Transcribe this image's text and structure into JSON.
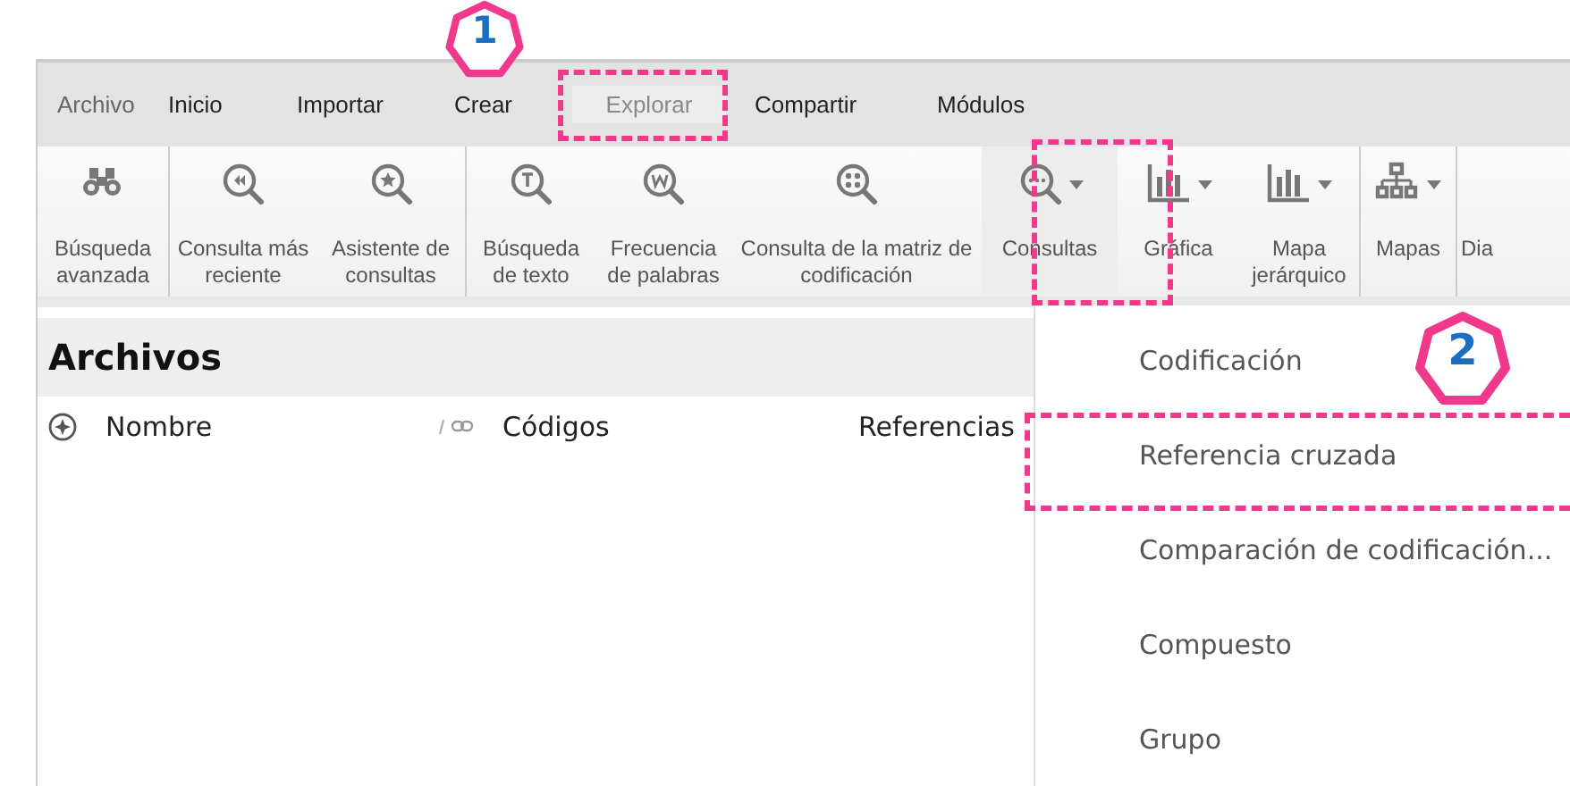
{
  "tabs": [
    {
      "label": "Archivo",
      "selected": false,
      "kind": "file"
    },
    {
      "label": "Inicio",
      "selected": false,
      "kind": "tab"
    },
    {
      "label": "Importar",
      "selected": false,
      "kind": "tab"
    },
    {
      "label": "Crear",
      "selected": false,
      "kind": "tab"
    },
    {
      "label": "Explorar",
      "selected": true,
      "kind": "tab"
    },
    {
      "label": "Compartir",
      "selected": false,
      "kind": "tab"
    },
    {
      "label": "Módulos",
      "selected": false,
      "kind": "tab"
    }
  ],
  "ribbon": [
    {
      "kind": "binoculars",
      "label": "Búsqueda avanzada",
      "dropdown": false,
      "selected": false,
      "group_end": true
    },
    {
      "kind": "rewind",
      "label": "Consulta más reciente",
      "dropdown": false,
      "selected": false,
      "group_end": false
    },
    {
      "kind": "star",
      "label": "Asistente de consultas",
      "dropdown": false,
      "selected": false,
      "group_end": true
    },
    {
      "kind": "letter-t",
      "label": "Búsqueda de texto",
      "dropdown": false,
      "selected": false,
      "group_end": false
    },
    {
      "kind": "letter-w",
      "label": "Frecuencia de palabras",
      "dropdown": false,
      "selected": false,
      "group_end": false
    },
    {
      "kind": "grid",
      "label": "Consulta de la matriz de codificación",
      "dropdown": false,
      "selected": false,
      "group_end": false
    },
    {
      "kind": "dots",
      "label": "Consultas",
      "dropdown": true,
      "selected": true,
      "group_end": false
    },
    {
      "kind": "bars",
      "label": "Gráfica",
      "dropdown": true,
      "selected": false,
      "group_end": false
    },
    {
      "kind": "bars",
      "label": "Mapa jerárquico",
      "dropdown": true,
      "selected": false,
      "group_end": true
    },
    {
      "kind": "tree",
      "label": "Mapas",
      "dropdown": true,
      "selected": false,
      "group_end": true
    },
    {
      "kind": "none",
      "label": "Dia",
      "dropdown": false,
      "selected": false,
      "group_end": false
    }
  ],
  "panel": {
    "title": "Archivos",
    "columns": [
      "Nombre",
      "Códigos",
      "Referencias"
    ]
  },
  "menu": [
    {
      "label": "Codificación"
    },
    {
      "label": "Referencia cruzada"
    },
    {
      "label": "Comparación de codificación..."
    },
    {
      "label": "Compuesto"
    },
    {
      "label": "Grupo"
    }
  ],
  "annotations": [
    {
      "kind": "badge",
      "label": "1"
    },
    {
      "kind": "badge",
      "label": "2"
    },
    {
      "kind": "box"
    },
    {
      "kind": "box"
    },
    {
      "kind": "box"
    }
  ]
}
